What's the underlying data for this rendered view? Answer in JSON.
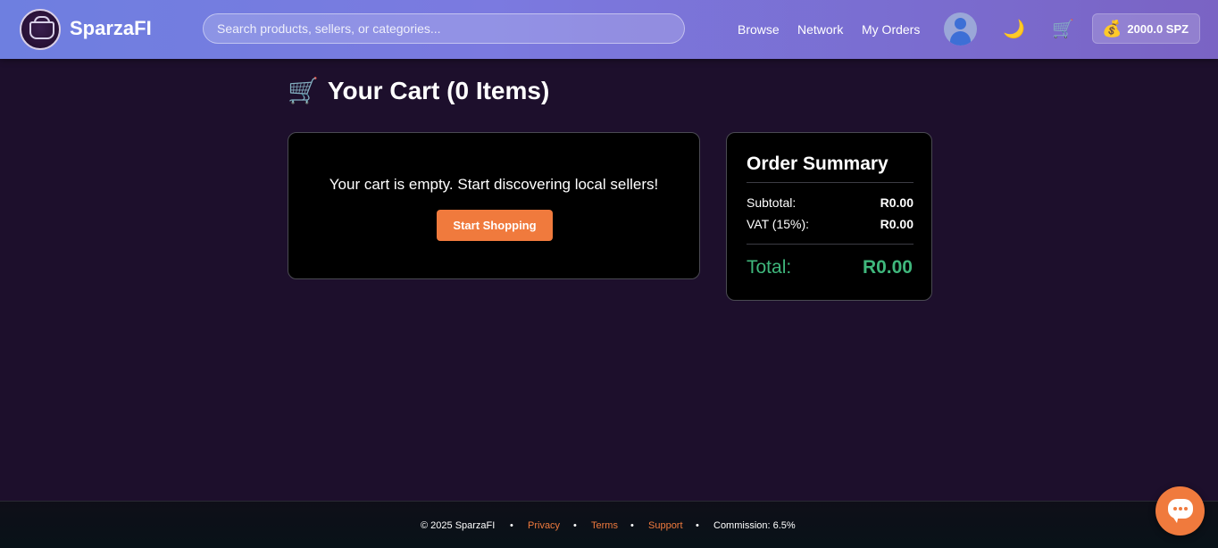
{
  "header": {
    "brand": "SparzaFI",
    "search_placeholder": "Search products, sellers, or categories...",
    "nav": [
      "Browse",
      "Network",
      "My Orders"
    ],
    "theme_icon": "🌙",
    "cart_icon": "🛒",
    "wallet_icon": "💰",
    "wallet_balance": "2000.0 SPZ"
  },
  "main": {
    "title_icon": "🛒",
    "title": "Your Cart (0 Items)",
    "empty_message": "Your cart is empty. Start discovering local sellers!",
    "start_button": "Start Shopping"
  },
  "summary": {
    "title": "Order Summary",
    "subtotal_label": "Subtotal:",
    "subtotal_value": "R0.00",
    "vat_label": "VAT (15%):",
    "vat_value": "R0.00",
    "total_label": "Total:",
    "total_value": "R0.00"
  },
  "footer": {
    "copyright": "© 2025 SparzaFI",
    "separator": "•",
    "privacy": "Privacy",
    "terms": "Terms",
    "support": "Support",
    "commission": "Commission: 6.5%"
  },
  "colors": {
    "accent": "#f07a3d",
    "total_green": "#3fb77c",
    "page_bg": "#1d0f2c"
  },
  "icons": [
    "logo",
    "user-avatar-icon",
    "moon-icon",
    "cart-icon",
    "money-bag-icon",
    "chat-icon"
  ]
}
